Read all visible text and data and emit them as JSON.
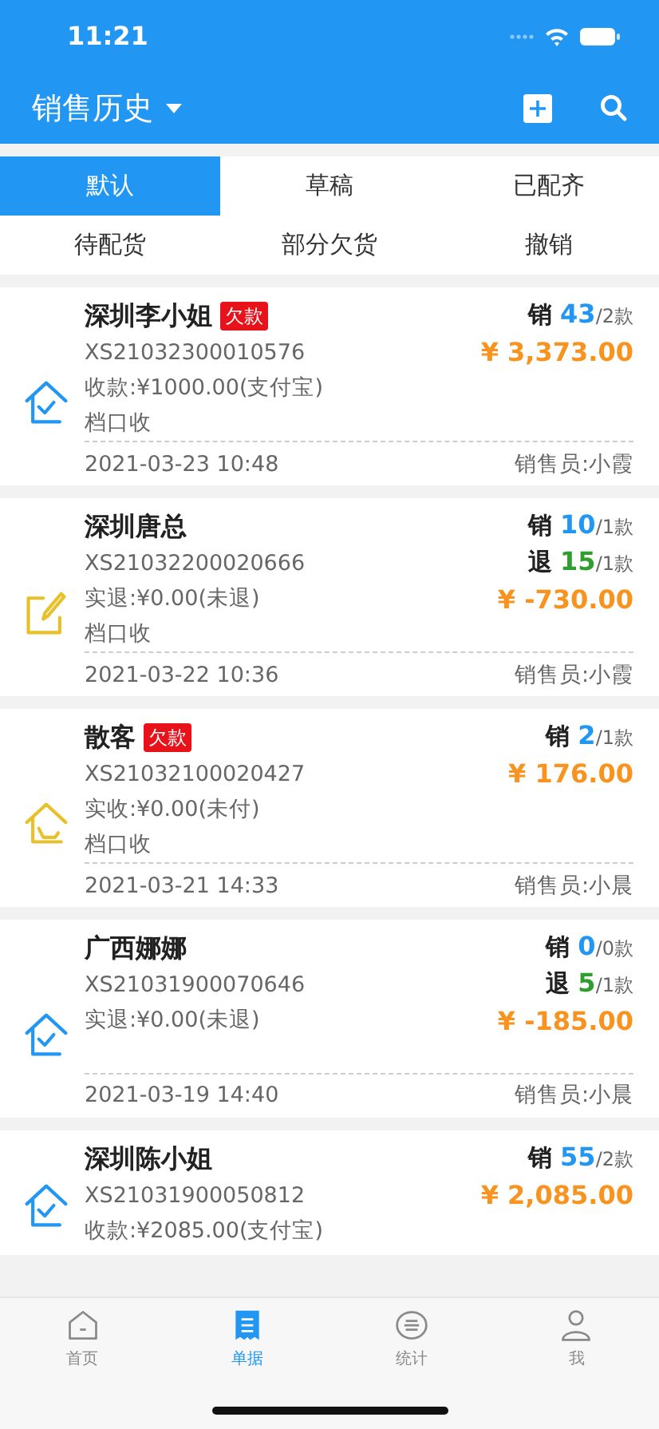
{
  "status_bar": {
    "time": "11:21"
  },
  "header": {
    "title": "销售历史"
  },
  "filters": [
    {
      "label": "默认",
      "selected": true
    },
    {
      "label": "草稿",
      "selected": false
    },
    {
      "label": "已配齐",
      "selected": false
    },
    {
      "label": "待配货",
      "selected": false
    },
    {
      "label": "部分欠货",
      "selected": false
    },
    {
      "label": "撤销",
      "selected": false
    }
  ],
  "orders": [
    {
      "kind": "done",
      "customer": "深圳李小姐",
      "tag": "欠款",
      "number": "XS21032300010576",
      "payment": "收款:¥1000.00(支付宝)",
      "delivery": "档口收",
      "counts": [
        {
          "kind": "sale",
          "label": "销",
          "qty": "43",
          "items": "/2款"
        }
      ],
      "total": "¥ 3,373.00",
      "time": "2021-03-23 10:48",
      "seller": "销售员:小霞"
    },
    {
      "kind": "draft",
      "customer": "深圳唐总",
      "number": "XS21032200020666",
      "payment": "实退:¥0.00(未退)",
      "delivery": "档口收",
      "counts": [
        {
          "kind": "sale",
          "label": "销",
          "qty": "10",
          "items": "/1款"
        },
        {
          "kind": "return",
          "label": "退",
          "qty": "15",
          "items": "/1款"
        }
      ],
      "total": "¥ -730.00",
      "time": "2021-03-22 10:36",
      "seller": "销售员:小霞"
    },
    {
      "kind": "pending",
      "customer": "散客",
      "tag": "欠款",
      "number": "XS21032100020427",
      "payment": "实收:¥0.00(未付)",
      "delivery": "档口收",
      "counts": [
        {
          "kind": "sale",
          "label": "销",
          "qty": "2",
          "items": "/1款"
        }
      ],
      "total": "¥ 176.00",
      "time": "2021-03-21 14:33",
      "seller": "销售员:小晨"
    },
    {
      "kind": "done",
      "customer": "广西娜娜",
      "number": "XS21031900070646",
      "payment": "实退:¥0.00(未退)",
      "counts": [
        {
          "kind": "sale",
          "label": "销",
          "qty": "0",
          "items": "/0款"
        },
        {
          "kind": "return",
          "label": "退",
          "qty": "5",
          "items": "/1款"
        }
      ],
      "total": "¥ -185.00",
      "time": "2021-03-19 14:40",
      "seller": "销售员:小晨"
    },
    {
      "kind": "done",
      "customer": "深圳陈小姐",
      "number": "XS21031900050812",
      "payment": "收款:¥2085.00(支付宝)",
      "counts": [
        {
          "kind": "sale",
          "label": "销",
          "qty": "55",
          "items": "/2款"
        }
      ],
      "total": "¥ 2,085.00"
    }
  ],
  "tab_bar": [
    {
      "kind": "home",
      "label": "首页",
      "selected": false
    },
    {
      "kind": "docs",
      "label": "单据",
      "selected": true
    },
    {
      "kind": "stats",
      "label": "统计",
      "selected": false
    },
    {
      "kind": "me",
      "label": "我",
      "selected": false
    }
  ]
}
